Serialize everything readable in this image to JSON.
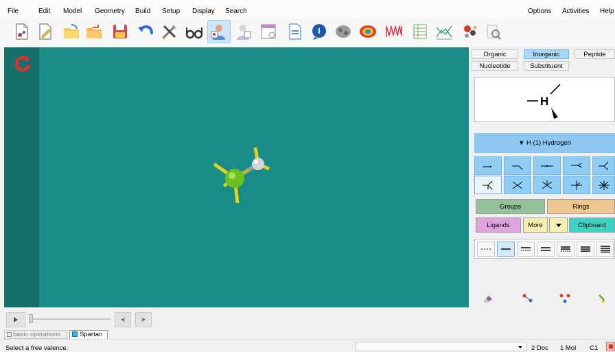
{
  "menu": [
    "File",
    "Edit",
    "Model",
    "Geometry",
    "Build",
    "Setup",
    "Display",
    "Search"
  ],
  "menu_right": [
    "Options",
    "Activities",
    "Help"
  ],
  "toolbar": {
    "icons": [
      "new-icon",
      "edit-icon",
      "open-icon",
      "open-recent-icon",
      "save-icon",
      "undo-icon",
      "tools-icon",
      "view-glasses-icon",
      "build-icon",
      "builder-icon",
      "calculations-icon",
      "output-icon",
      "info-icon",
      "surfaces-icon",
      "properties-icon",
      "potential-map-icon",
      "spectra-icon",
      "spreadsheet-icon",
      "plot-icon",
      "molecule-db-icon",
      "search-icon"
    ],
    "active_index": 8
  },
  "builder": {
    "tabs": [
      "Organic",
      "Inorganic",
      "Peptide",
      "Nucleotide",
      "Substituent"
    ],
    "selected_tab": "Inorganic",
    "element_label": "▼ H (1) Hydrogen",
    "preview_atom": "H",
    "buttons": {
      "groups": "Groups",
      "rings": "Rings",
      "ligands": "Ligands",
      "more": "More",
      "clipboard": "Clipboard"
    }
  },
  "doc_tabs": [
    "basic operations",
    "Spartan"
  ],
  "statusbar": {
    "message": "Select a free valence.",
    "doc_count": "2 Doc",
    "mol_count": "1 Mol",
    "symmetry": "C1"
  },
  "colors": {
    "viewport": "#1a8c88",
    "selected_tab": "#a8d6f5",
    "groups": "#93c19a",
    "rings": "#f0c690",
    "ligands": "#e0a3e0",
    "more": "#f6efae",
    "clipboard": "#3ed2c2"
  }
}
